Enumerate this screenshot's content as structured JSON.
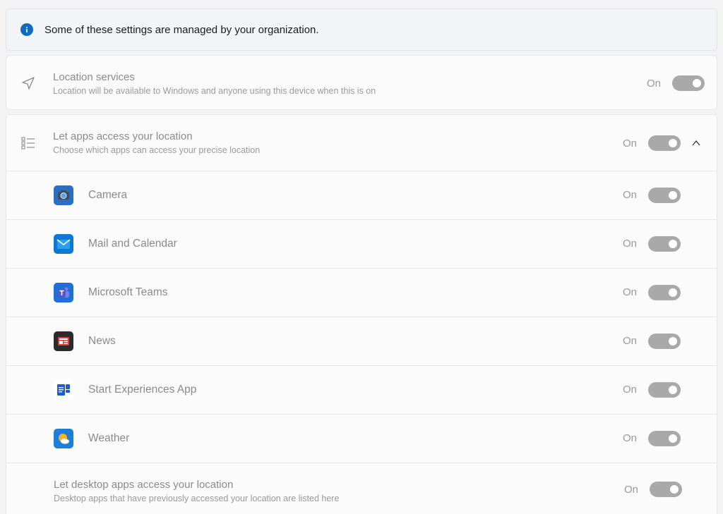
{
  "banner": {
    "text": "Some of these settings are managed by your organization.",
    "icon": "info-icon"
  },
  "location_services": {
    "title": "Location services",
    "subtitle": "Location will be available to Windows and anyone using this device when this is on",
    "state": "On",
    "icon": "location-arrow-icon"
  },
  "apps_access": {
    "title": "Let apps access your location",
    "subtitle": "Choose which apps can access your precise location",
    "state": "On",
    "icon": "list-icon",
    "apps": [
      {
        "name": "Camera",
        "state": "On",
        "icon": "camera-app-icon"
      },
      {
        "name": "Mail and Calendar",
        "state": "On",
        "icon": "mail-app-icon"
      },
      {
        "name": "Microsoft Teams",
        "state": "On",
        "icon": "teams-app-icon"
      },
      {
        "name": "News",
        "state": "On",
        "icon": "news-app-icon"
      },
      {
        "name": "Start Experiences App",
        "state": "On",
        "icon": "start-experiences-app-icon"
      },
      {
        "name": "Weather",
        "state": "On",
        "icon": "weather-app-icon"
      }
    ]
  },
  "desktop_apps": {
    "title": "Let desktop apps access your location",
    "subtitle": "Desktop apps that have previously accessed your location are listed here",
    "state": "On"
  },
  "colors": {
    "accent": "#0f6cbd",
    "toggle_disabled": "#a9a9a9"
  }
}
